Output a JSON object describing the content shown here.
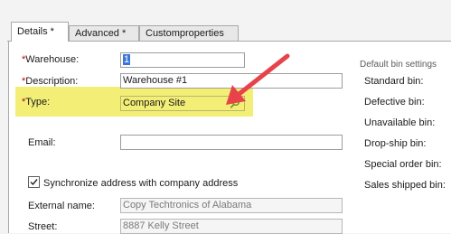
{
  "tabs": [
    {
      "label": "Details *"
    },
    {
      "label": "Advanced *"
    },
    {
      "label": "Customproperties"
    }
  ],
  "form": {
    "warehouse": {
      "required": "*",
      "label": "Warehouse:",
      "value": "1"
    },
    "description": {
      "required": "*",
      "label": "Description:",
      "value": "Warehouse #1"
    },
    "type": {
      "required": "*",
      "label": "Type:",
      "value": "Company Site"
    },
    "email": {
      "label": "Email:",
      "value": ""
    },
    "sync_address": {
      "label": "Synchronize address with company address",
      "checked": true
    },
    "external_name": {
      "label": "External name:",
      "value": "Copy Techtronics of Alabama"
    },
    "street": {
      "label": "Street:",
      "value": "8887 Kelly Street"
    }
  },
  "bin_settings": {
    "title": "Default bin settings",
    "items": [
      {
        "label": "Standard bin:"
      },
      {
        "label": "Defective bin:"
      },
      {
        "label": "Unavailable bin:"
      },
      {
        "label": "Drop-ship bin:"
      },
      {
        "label": "Special order bin:"
      },
      {
        "label": "Sales shipped bin:"
      }
    ]
  },
  "colors": {
    "highlight": "#f2ee6a",
    "arrow": "#e8434a",
    "required": "#c00000"
  },
  "icons": {
    "type_lookup": "magnifier-icon",
    "checkbox": "checkmark-icon"
  }
}
